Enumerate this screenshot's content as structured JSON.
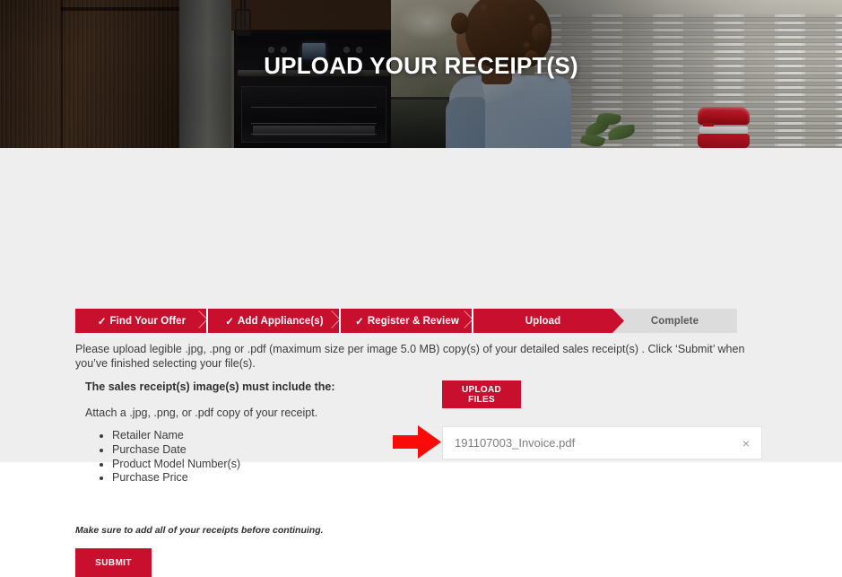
{
  "hero": {
    "title": "UPLOAD YOUR RECEIPT(S)",
    "scene_description": "kitchen-photo"
  },
  "progress": {
    "steps": [
      {
        "label": "Find Your Offer",
        "check": "✓",
        "state": "completed"
      },
      {
        "label": "Add Appliance(s)",
        "check": "✓",
        "state": "completed"
      },
      {
        "label": "Register & Review",
        "check": "✓",
        "state": "completed"
      },
      {
        "label": "Upload",
        "check": "",
        "state": "current"
      },
      {
        "label": "Complete",
        "check": "",
        "state": "upcoming"
      }
    ],
    "active_color": "#c8102e",
    "inactive_color": "#dcdcdc",
    "inactive_text_color": "#58585a"
  },
  "intro": {
    "text": "Please upload legible .jpg, .png or .pdf (maximum size per image 5.0 MB) copy(s) of your detailed sales receipt(s) . Click ‘Submit’ when you’ve finished selecting your file(s)."
  },
  "requirements": {
    "heading": "The sales receipt(s) image(s) must include the:",
    "attach_text": "Attach a .jpg, .png, or .pdf copy of your receipt.",
    "items": [
      "Retailer Name",
      "Purchase Date",
      "Product Model Number(s)",
      "Purchase Price"
    ]
  },
  "upload": {
    "button_label": "UPLOAD FILES",
    "file": {
      "name": "191107003_Invoice.pdf",
      "remove_icon": "×"
    },
    "annotation": {
      "type": "arrow-right",
      "color": "#fb0a0a"
    }
  },
  "footer": {
    "note": "Make sure to add all of your receipts before continuing.",
    "submit_label": "SUBMIT"
  },
  "theme": {
    "brand_red": "#c8102e",
    "page_background": "#efeeee",
    "body_text": "#3c3c3c"
  }
}
